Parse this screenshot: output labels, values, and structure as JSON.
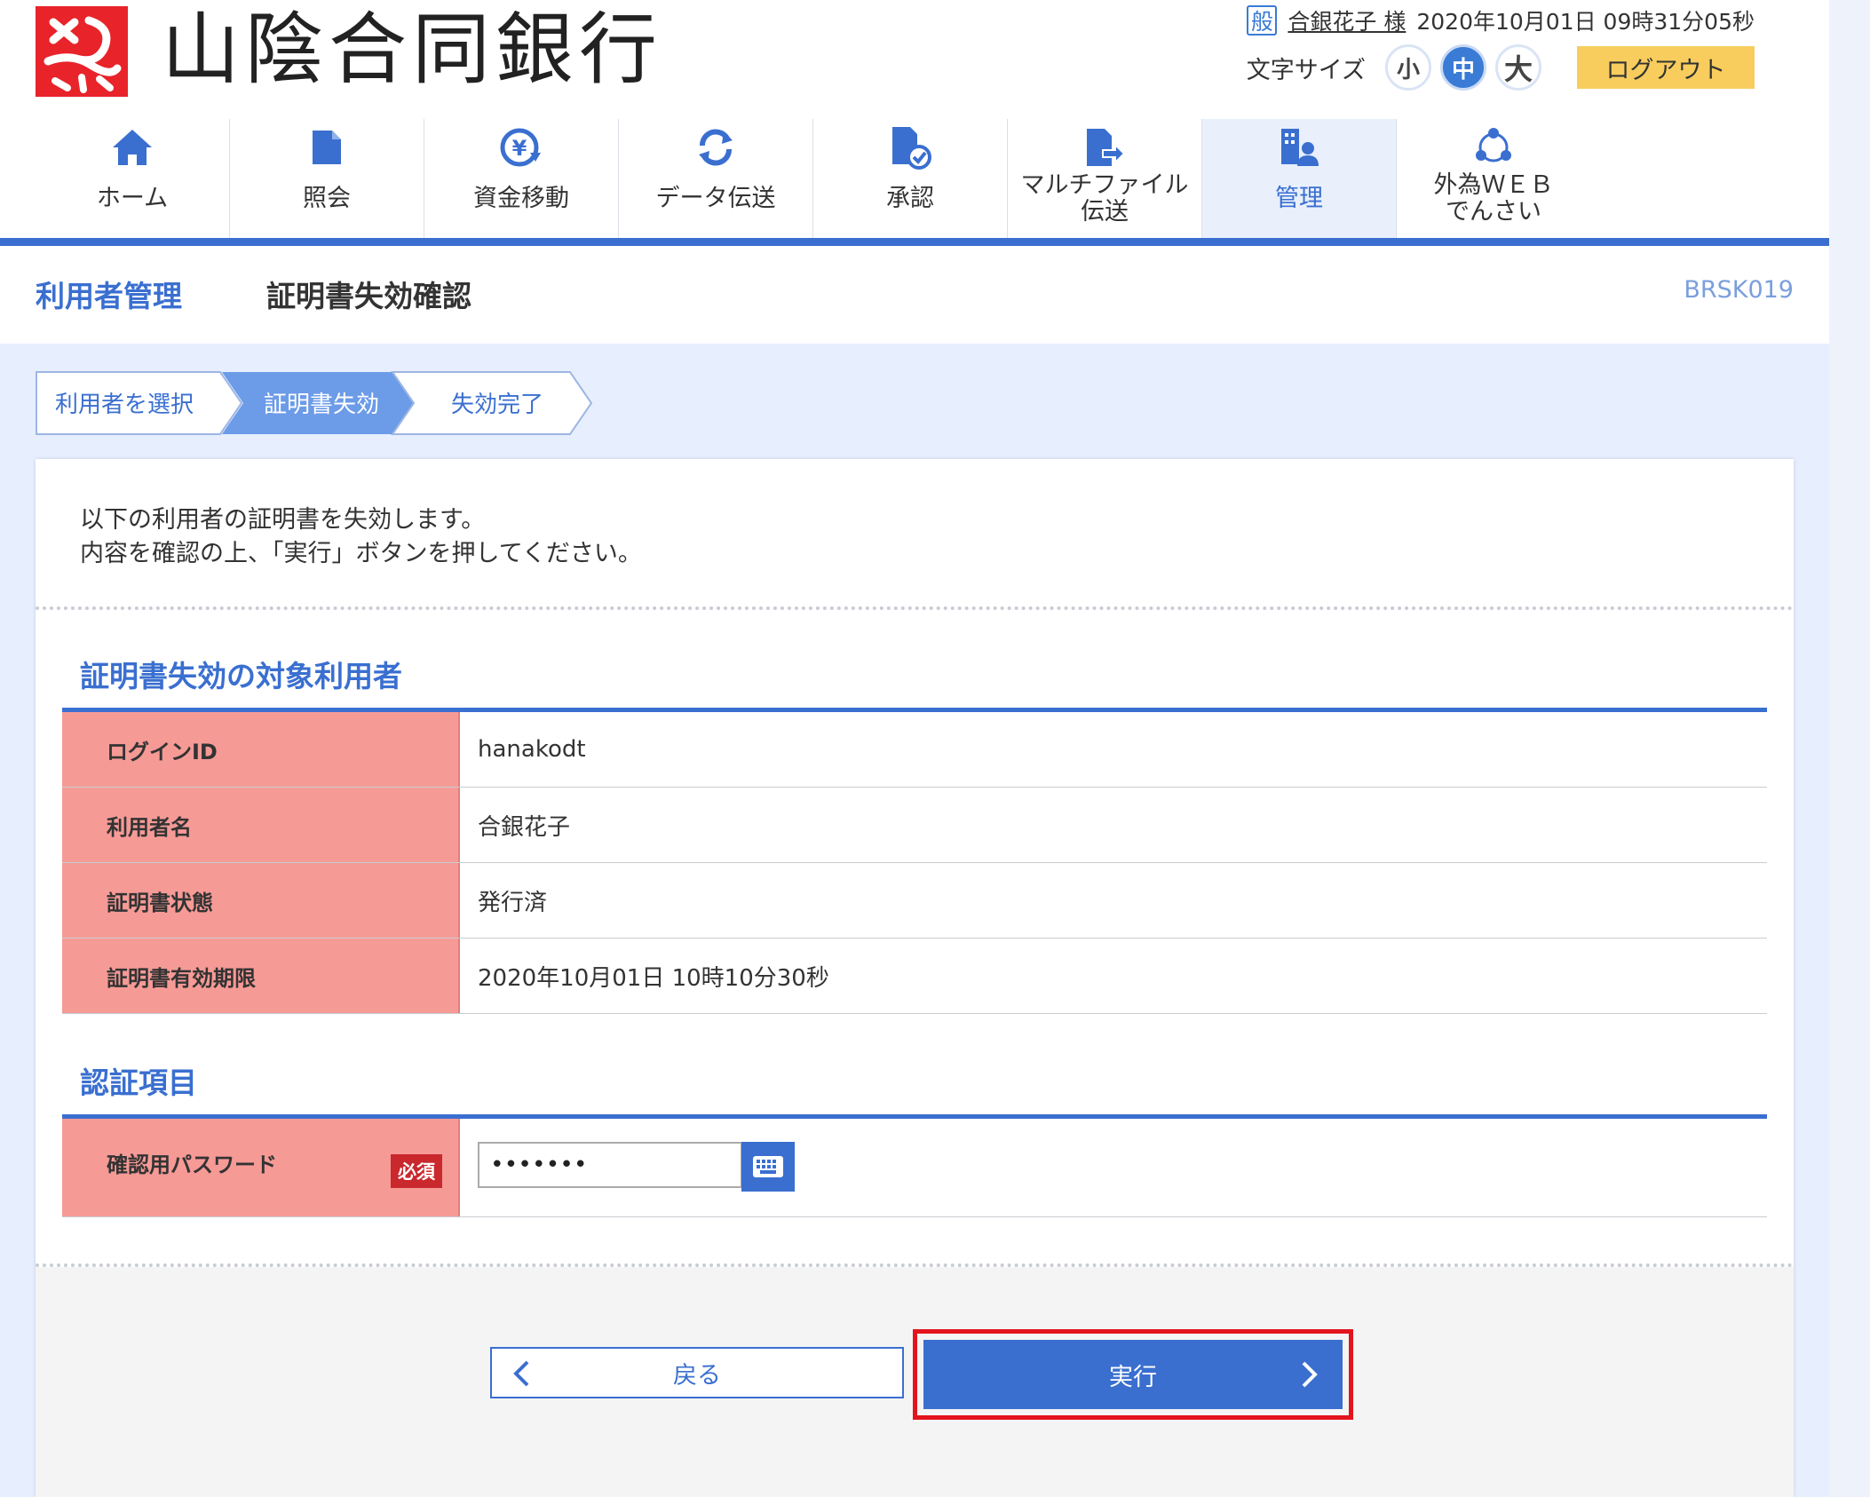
{
  "bank_name": "山陰合同銀行",
  "header": {
    "account_badge": "般",
    "user_name": "合銀花子 様",
    "datetime": "2020年10月01日 09時31分05秒",
    "font_size_label": "文字サイズ",
    "font_sizes": [
      "小",
      "中",
      "大"
    ],
    "logout_label": "ログアウト"
  },
  "nav": [
    {
      "label": "ホーム",
      "icon": "home-icon"
    },
    {
      "label": "照会",
      "icon": "document-icon"
    },
    {
      "label": "資金移動",
      "icon": "yen-transfer-icon"
    },
    {
      "label": "データ伝送",
      "icon": "sync-icon"
    },
    {
      "label": "承認",
      "icon": "approve-icon"
    },
    {
      "label": "マルチファイル\n伝送",
      "icon": "file-send-icon"
    },
    {
      "label": "管理",
      "icon": "building-user-icon",
      "active": true
    },
    {
      "label": "外為ＷＥＢ\nでんさい",
      "icon": "network-icon"
    }
  ],
  "title": {
    "section": "利用者管理",
    "page": "証明書失効確認",
    "code": "BRSK019"
  },
  "steps": [
    "利用者を選択",
    "証明書失効",
    "失効完了"
  ],
  "intro": {
    "line1": "以下の利用者の証明書を失効します。",
    "line2": "内容を確認の上、「実行」ボタンを押してください。"
  },
  "target_section": {
    "title": "証明書失効の対象利用者",
    "rows": [
      {
        "label": "ログインID",
        "value": "hanakodt"
      },
      {
        "label": "利用者名",
        "value": "合銀花子"
      },
      {
        "label": "証明書状態",
        "value": "発行済"
      },
      {
        "label": "証明書有効期限",
        "value": "2020年10月01日 10時10分30秒"
      }
    ]
  },
  "auth_section": {
    "title": "認証項目",
    "password_label": "確認用パスワード",
    "required_label": "必須",
    "password_value": "•••••••"
  },
  "buttons": {
    "back": "戻る",
    "execute": "実行"
  },
  "colors": {
    "primary": "#3a6fd0",
    "label_bg": "#f69a96",
    "required": "#c9282d",
    "logout": "#f8cd5d",
    "highlight": "#e3141d"
  }
}
